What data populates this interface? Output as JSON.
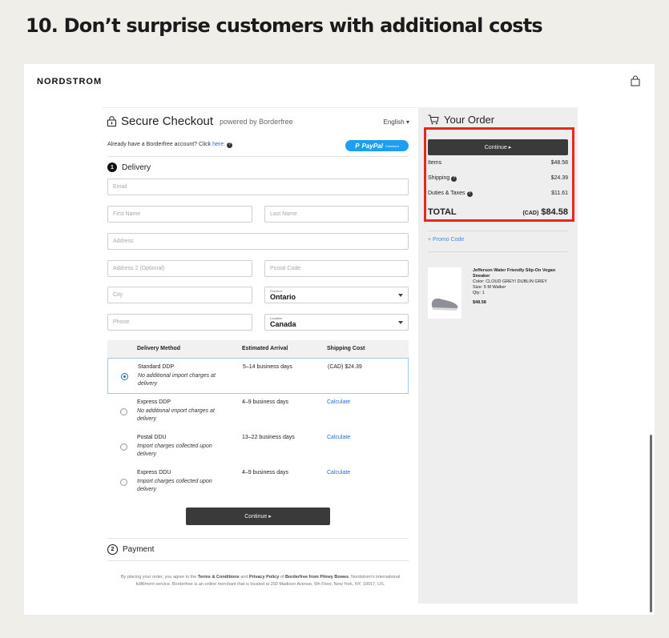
{
  "headline": "10. Don’t surprise customers with additional costs",
  "site": {
    "logo": "NORDSTROM",
    "bag_icon": "shopping-bag-icon"
  },
  "checkout": {
    "title": "Secure Checkout",
    "powered_by": "powered by Borderfree",
    "language": "English",
    "account_prompt": "Already have a Borderfree account? Click",
    "account_link": "here.",
    "paypal_label": "PayPal",
    "paypal_sub": "Checkout",
    "delivery_step": {
      "number": "1",
      "label": "Delivery"
    },
    "fields": {
      "email": "Email",
      "first_name": "First Name",
      "last_name": "Last Name",
      "address": "Address",
      "address2": "Address 2 (Optional)",
      "postal": "Postal Code",
      "city": "City",
      "phone": "Phone"
    },
    "province": {
      "label": "Province",
      "value": "Ontario"
    },
    "location": {
      "label": "Location",
      "value": "Canada"
    },
    "table_headers": {
      "method": "Delivery Method",
      "arrival": "Estimated Arrival",
      "cost": "Shipping Cost"
    },
    "methods": [
      {
        "name": "Standard DDP",
        "desc": "No additional import charges at delivery",
        "arrival": "5–14 business days",
        "cost": "(CAD) $24.39",
        "selected": true
      },
      {
        "name": "Express DDP",
        "desc": "No additional import charges at delivery",
        "arrival": "4–9 business days",
        "cost": "Calculate",
        "selected": false
      },
      {
        "name": "Postal DDU",
        "desc": "Import charges collected upon delivery",
        "arrival": "13–22 business days",
        "cost": "Calculate",
        "selected": false
      },
      {
        "name": "Express DDU",
        "desc": "Import charges collected upon delivery",
        "arrival": "4–9 business days",
        "cost": "Calculate",
        "selected": false
      }
    ],
    "continue_label": "Continue ▸",
    "payment_step": {
      "number": "2",
      "label": "Payment"
    },
    "legal": {
      "pre": "By placing your order, you agree to the",
      "terms": "Terms & Conditions",
      "and": "and",
      "privacy": "Privacy Policy",
      "of": "of",
      "company": "Borderfree from Pitney Bowes",
      "post": ", Nordstrom's international fulfillment service. Borderfree is an online merchant that is located at 292 Madison Avenue, 5th Floor, New York, NY, 10017, US."
    }
  },
  "order": {
    "title": "Your Order",
    "continue_label": "Continue ▸",
    "items_label": "Items",
    "items_value": "$48.58",
    "shipping_label": "Shipping",
    "shipping_value": "$24.39",
    "duties_label": "Duties & Taxes",
    "duties_value": "$11.61",
    "total_label": "TOTAL",
    "total_currency": "(CAD)",
    "total_value": "$84.58",
    "promo": "+ Promo Code",
    "product": {
      "name": "Jefferson Water Friendly Slip-On Vegan Sneaker",
      "color": "Color: CLOUD GREY/ DUBLIN GREY",
      "size": "Size: 5 M Walker",
      "qty": "Qty: 1",
      "price": "$48.58"
    }
  },
  "colors": {
    "highlight": "#e6291b",
    "link": "#1f6fd1",
    "paypal": "#1c9ff0",
    "button": "#3a3a3a"
  }
}
